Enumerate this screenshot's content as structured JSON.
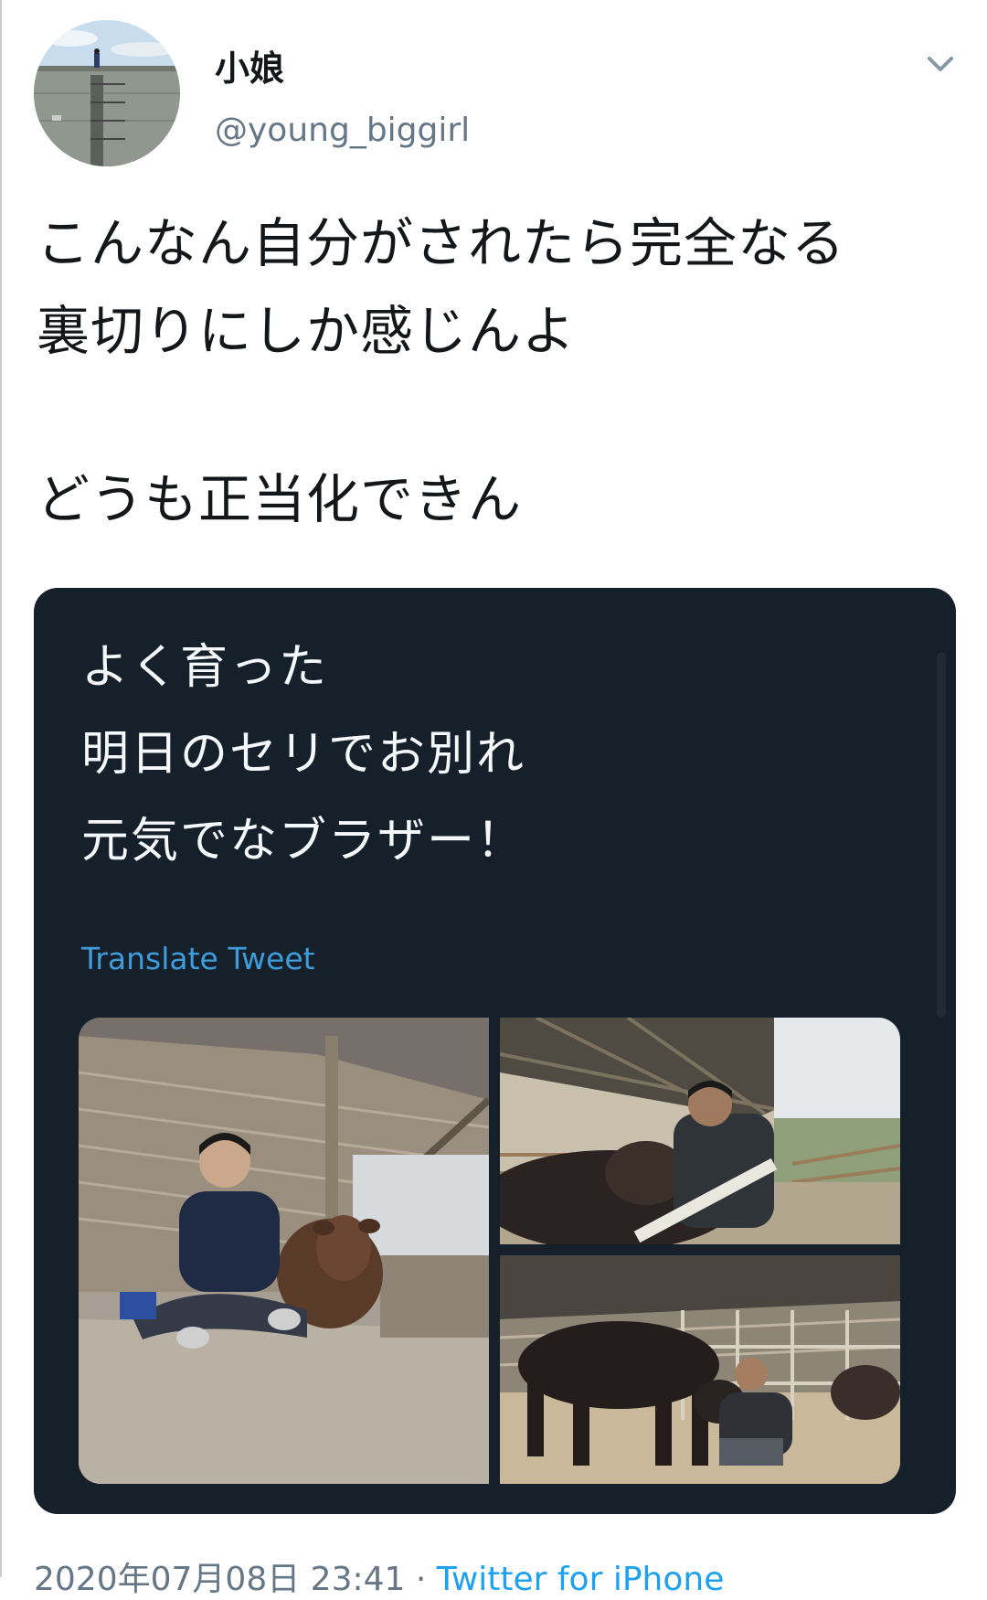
{
  "author": {
    "display_name": "小娘",
    "handle": "@young_biggirl"
  },
  "tweet": {
    "lines": [
      "こんなん自分がされたら完全なる",
      "裏切りにしか感じんよ",
      "どうも正当化できん"
    ]
  },
  "quoted_tweet": {
    "lines": [
      "よく育った",
      "明日のセリでお別れ",
      "元気でなブラザー！"
    ],
    "translate_label": "Translate Tweet",
    "photos": [
      "man-sitting-with-calf-in-barn-photo",
      "man-hugging-cow-over-fence-photo",
      "man-crouching-with-calf-photo"
    ]
  },
  "meta": {
    "timestamp": "2020年07月08日 23:41",
    "separator": " · ",
    "source": "Twitter for iPhone"
  },
  "icons": {
    "menu": "chevron-down-icon"
  },
  "colors": {
    "card_bg": "#15202b",
    "link": "#3f9ddc",
    "secondary_text": "#657786"
  }
}
